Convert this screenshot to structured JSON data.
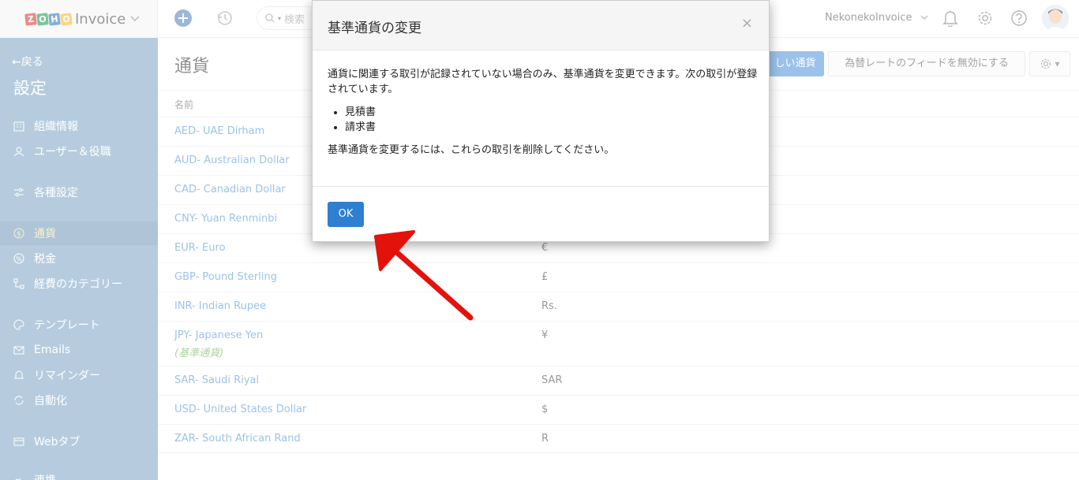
{
  "app": {
    "brand_letters": [
      "Z",
      "O",
      "H",
      "O"
    ],
    "brand_name": "Invoice",
    "search_placeholder": "検索",
    "org_name": "NekonekoInvoice",
    "colors": {
      "accent": "#4a90d9",
      "sidebar": "#7aa3c4",
      "sidebar_active_text": "#f4e9a6",
      "link": "#4a90d9",
      "base_label": "#6ab04c",
      "ok_button": "#2e7fd1",
      "arrow": "#e3120b"
    }
  },
  "sidebar": {
    "back_label": "←戻る",
    "title": "設定",
    "items": [
      {
        "label": "組織情報",
        "icon": "building-icon"
      },
      {
        "label": "ユーザー＆役職",
        "icon": "users-icon"
      },
      {
        "label": "各種設定",
        "icon": "sliders-icon"
      },
      {
        "label": "通貨",
        "icon": "currency-icon",
        "active": true
      },
      {
        "label": "税金",
        "icon": "percent-icon"
      },
      {
        "label": "経費のカテゴリー",
        "icon": "category-icon"
      },
      {
        "label": "テンプレート",
        "icon": "palette-icon"
      },
      {
        "label": "Emails",
        "icon": "mail-icon"
      },
      {
        "label": "リマインダー",
        "icon": "bell-icon"
      },
      {
        "label": "自動化",
        "icon": "sync-icon"
      },
      {
        "label": "Webタブ",
        "icon": "webtab-icon"
      },
      {
        "label": "連携",
        "icon": "link-icon"
      }
    ]
  },
  "main": {
    "title": "通貨",
    "new_button": "しい通貨",
    "disable_feed_button": "為替レートのフィードを無効にする",
    "column_name": "名前",
    "currencies": [
      {
        "name": "AED- UAE Dirham",
        "symbol": ""
      },
      {
        "name": "AUD- Australian Dollar",
        "symbol": ""
      },
      {
        "name": "CAD- Canadian Dollar",
        "symbol": ""
      },
      {
        "name": "CNY- Yuan Renminbi",
        "symbol": ""
      },
      {
        "name": "EUR- Euro",
        "symbol": "€"
      },
      {
        "name": "GBP- Pound Sterling",
        "symbol": "£"
      },
      {
        "name": "INR- Indian Rupee",
        "symbol": "Rs."
      },
      {
        "name": "JPY- Japanese Yen",
        "symbol": "¥",
        "base_label": "(基準通貨)"
      },
      {
        "name": "SAR- Saudi Riyal",
        "symbol": "SAR"
      },
      {
        "name": "USD- United States Dollar",
        "symbol": "$"
      },
      {
        "name": "ZAR- South African Rand",
        "symbol": "R"
      }
    ]
  },
  "modal": {
    "title": "基準通貨の変更",
    "close": "×",
    "message": "通貨に関連する取引が記録されていない場合のみ、基準通貨を変更できます。次の取引が登録されています。",
    "transactions": [
      "見積書",
      "請求書"
    ],
    "instruction": "基準通貨を変更するには、これらの取引を削除してください。",
    "ok_label": "OK"
  }
}
